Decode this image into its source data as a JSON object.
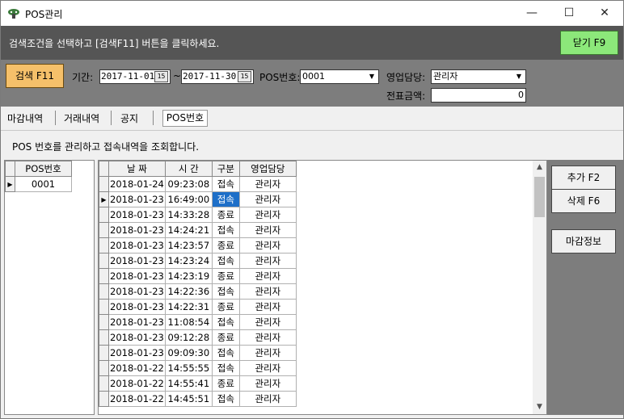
{
  "window": {
    "title": "POS관리",
    "minimize": "—",
    "maximize": "☐",
    "close": "✕"
  },
  "hint": {
    "text": "검색조건을 선택하고 [검색F11] 버튼을 클릭하세요.",
    "close_label": "닫기 F9"
  },
  "search": {
    "button_label": "검색 F11",
    "period_label": "기간:",
    "date_from": "2017-11-01",
    "tilde": "~",
    "date_to": "2017-11-30",
    "cal_icon": "15",
    "pos_label": "POS번호:",
    "pos_value": "0001",
    "sales_label": "영업담당:",
    "sales_value": "관리자",
    "amount_label": "전표금액:",
    "amount_value": "0"
  },
  "tabs": [
    "마감내역",
    "거래내역",
    "공지",
    "POS번호"
  ],
  "description": "POS 번호를 관리하고 접속내역을 조회합니다.",
  "pos_grid": {
    "header": "POS번호",
    "rows": [
      "0001"
    ]
  },
  "log_grid": {
    "headers": [
      "날 짜",
      "시 간",
      "구분",
      "영업담당"
    ],
    "rows": [
      [
        "2018-01-24",
        "09:23:08",
        "접속",
        "관리자"
      ],
      [
        "2018-01-23",
        "16:49:00",
        "접속",
        "관리자"
      ],
      [
        "2018-01-23",
        "14:33:28",
        "종료",
        "관리자"
      ],
      [
        "2018-01-23",
        "14:24:21",
        "접속",
        "관리자"
      ],
      [
        "2018-01-23",
        "14:23:57",
        "종료",
        "관리자"
      ],
      [
        "2018-01-23",
        "14:23:24",
        "접속",
        "관리자"
      ],
      [
        "2018-01-23",
        "14:23:19",
        "종료",
        "관리자"
      ],
      [
        "2018-01-23",
        "14:22:36",
        "접속",
        "관리자"
      ],
      [
        "2018-01-23",
        "14:22:31",
        "종료",
        "관리자"
      ],
      [
        "2018-01-23",
        "11:08:54",
        "접속",
        "관리자"
      ],
      [
        "2018-01-23",
        "09:12:28",
        "종료",
        "관리자"
      ],
      [
        "2018-01-23",
        "09:09:30",
        "접속",
        "관리자"
      ],
      [
        "2018-01-22",
        "14:55:55",
        "접속",
        "관리자"
      ],
      [
        "2018-01-22",
        "14:55:41",
        "종료",
        "관리자"
      ],
      [
        "2018-01-22",
        "14:45:51",
        "접속",
        "관리자"
      ]
    ]
  },
  "side_buttons": {
    "add": "추가 F2",
    "delete": "삭제 F6",
    "close_info": "마감정보"
  },
  "colors": {
    "close_button": "#8ce87a",
    "search_button": "#f5c06a",
    "selection": "#1e6fc8"
  }
}
